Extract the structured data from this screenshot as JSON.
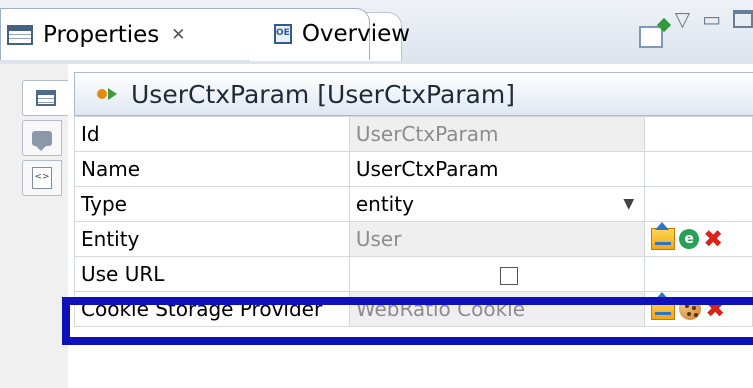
{
  "tabs": [
    {
      "label": "Properties",
      "close": "✕",
      "active": true
    },
    {
      "label": "Overview",
      "icon_text": "OE",
      "active": false
    }
  ],
  "toolbar": {
    "menu_glyph": "▽",
    "minimize_glyph": "▭"
  },
  "side_tabs": [
    "general-icon",
    "comment-icon",
    "xml-icon"
  ],
  "header": {
    "title": "UserCtxParam [UserCtxParam]"
  },
  "properties": [
    {
      "name": "Id",
      "value": "UserCtxParam"
    },
    {
      "name": "Name",
      "value": "UserCtxParam"
    },
    {
      "name": "Type",
      "value": "entity"
    },
    {
      "name": "Entity",
      "value": "User"
    },
    {
      "name": "Use URL",
      "value": ""
    },
    {
      "name": "Cookie Storage Provider",
      "value": "WebRatio Cookie"
    }
  ],
  "entity_icon_text": "e",
  "colors": {
    "highlight": "#1010b8",
    "header_bg": "#dfe8f2",
    "readonly_bg": "#efefef"
  }
}
